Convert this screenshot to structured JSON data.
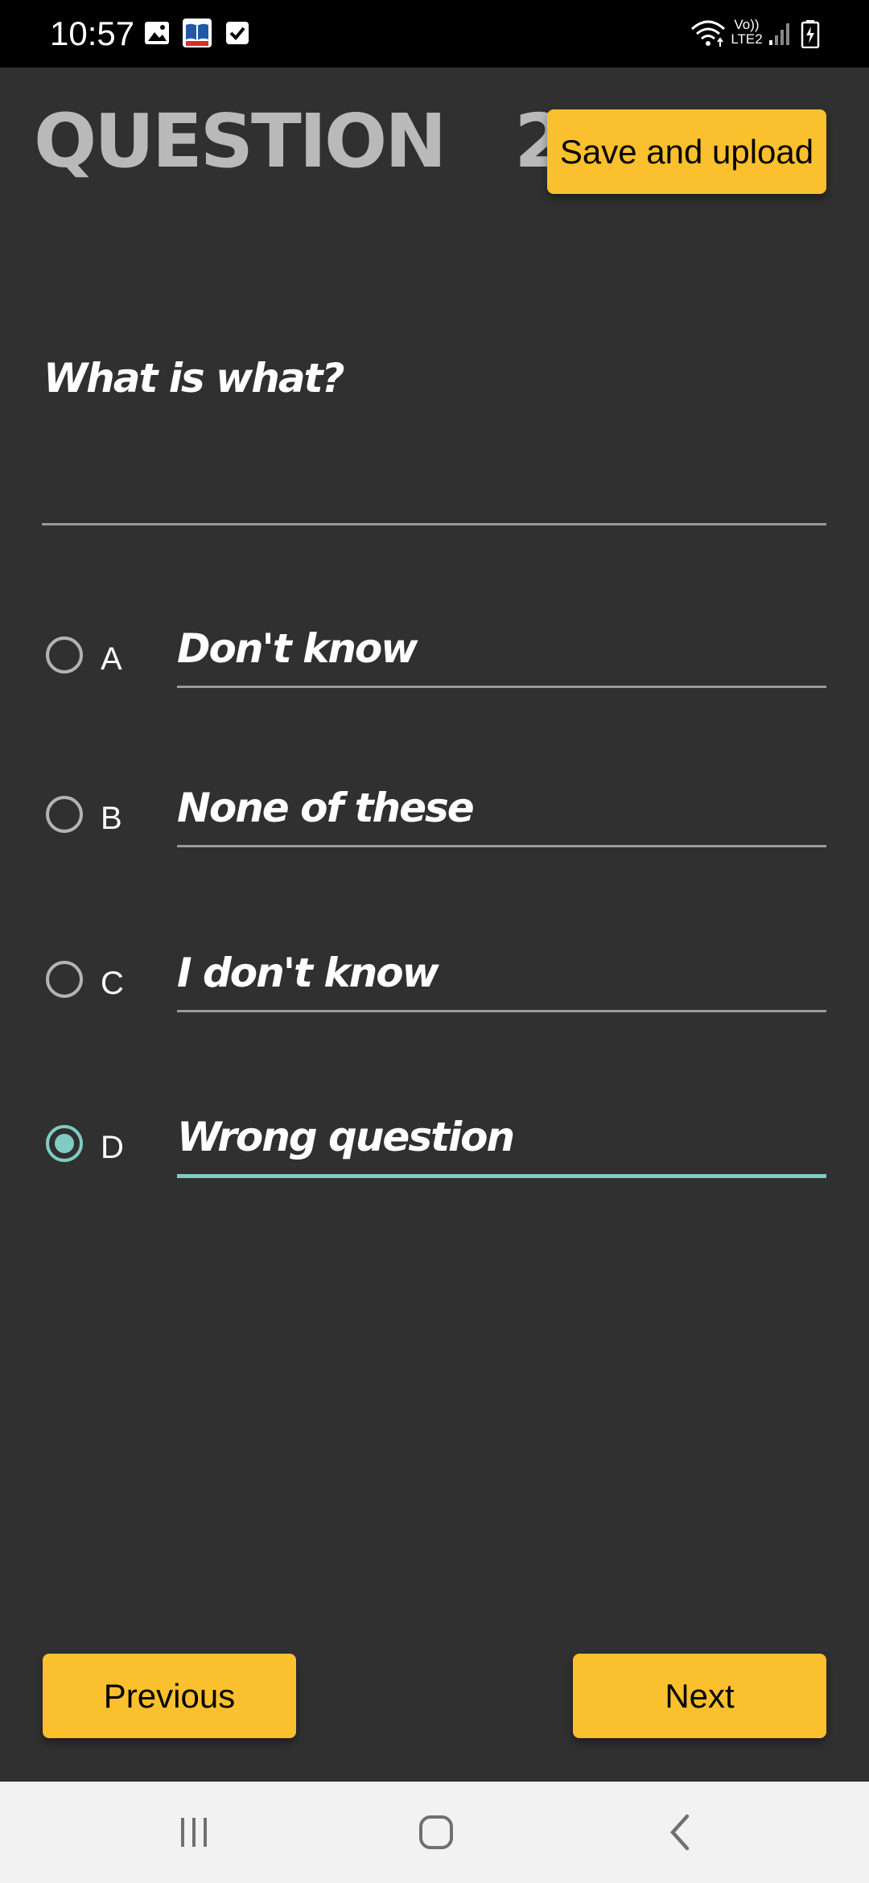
{
  "status_bar": {
    "time": "10:57",
    "network_label_top": "Vo))",
    "network_label_bottom": "LTE2",
    "icons": [
      "image-icon",
      "book-app-icon",
      "checkbox-icon",
      "wifi-icon",
      "signal-icon",
      "battery-charging-icon"
    ]
  },
  "header": {
    "title": "QUESTION   2",
    "save_label": "Save and upload"
  },
  "question": {
    "text": "What is what?"
  },
  "options": [
    {
      "letter": "A",
      "text": "Don't know",
      "selected": false
    },
    {
      "letter": "B",
      "text": "None of these",
      "selected": false
    },
    {
      "letter": "C",
      "text": "I don't know",
      "selected": false
    },
    {
      "letter": "D",
      "text": "Wrong question",
      "selected": true
    }
  ],
  "footer": {
    "previous_label": "Previous",
    "next_label": "Next"
  },
  "nav_bar": {
    "icons": [
      "recent-apps-icon",
      "home-icon",
      "back-icon"
    ]
  },
  "colors": {
    "background": "#303030",
    "accent_button": "#fbc02d",
    "selected_accent": "#80cbc4",
    "title_grey": "#b9b9b9"
  }
}
